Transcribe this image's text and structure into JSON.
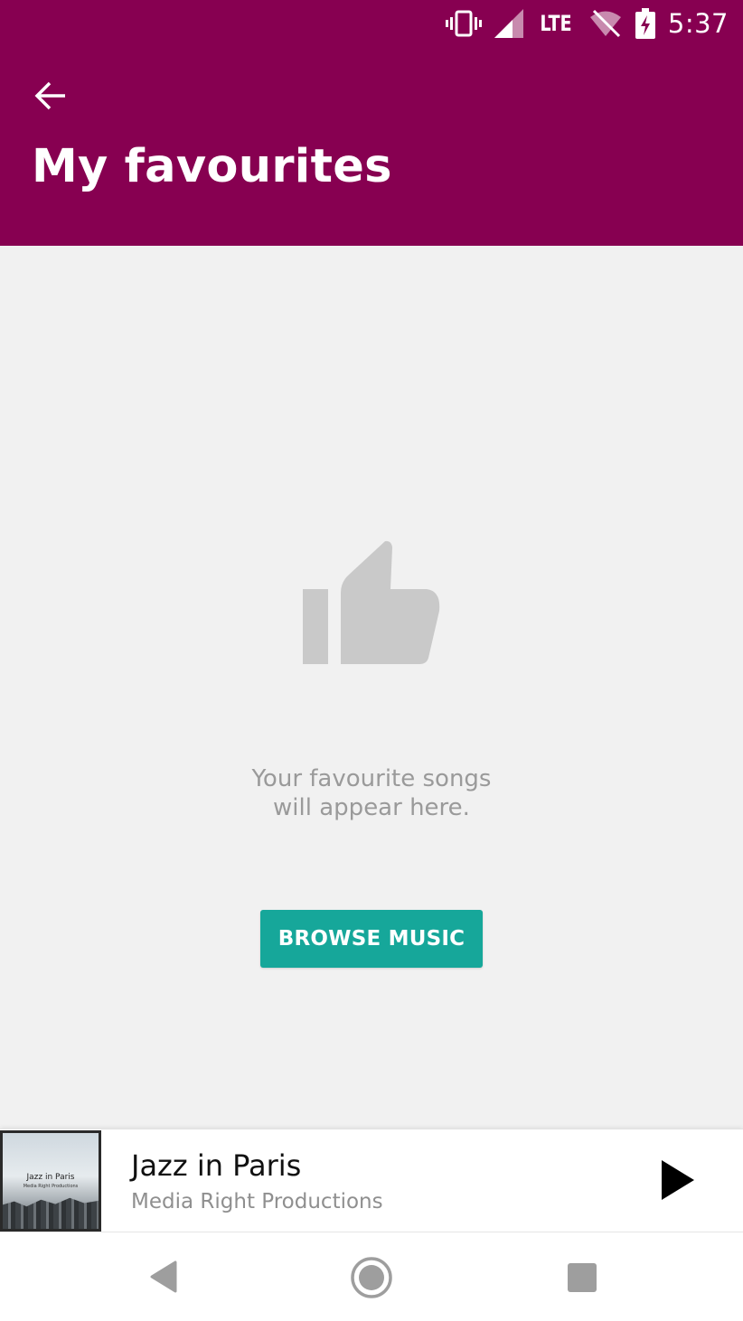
{
  "status_bar": {
    "time": "5:37",
    "network": "LTE",
    "icons": [
      "vibrate-icon",
      "signal-icon",
      "wifi-off-icon",
      "battery-charging-icon"
    ]
  },
  "header": {
    "title": "My favourites",
    "background_color": "#870051",
    "back_icon": "arrow-back-icon"
  },
  "empty_state": {
    "icon": "thumbs-up-icon",
    "message_line1": "Your favourite songs",
    "message_line2": "will appear here.",
    "button_label": "BROWSE MUSIC",
    "button_color": "#16a79a"
  },
  "mini_player": {
    "album_art_title": "Jazz in Paris",
    "album_art_subtitle": "Media Right Productions",
    "track_title": "Jazz in Paris",
    "track_artist": "Media Right Productions",
    "play_icon": "play-icon"
  },
  "nav_bar": {
    "icons": [
      "nav-back-icon",
      "nav-home-icon",
      "nav-recents-icon"
    ]
  }
}
